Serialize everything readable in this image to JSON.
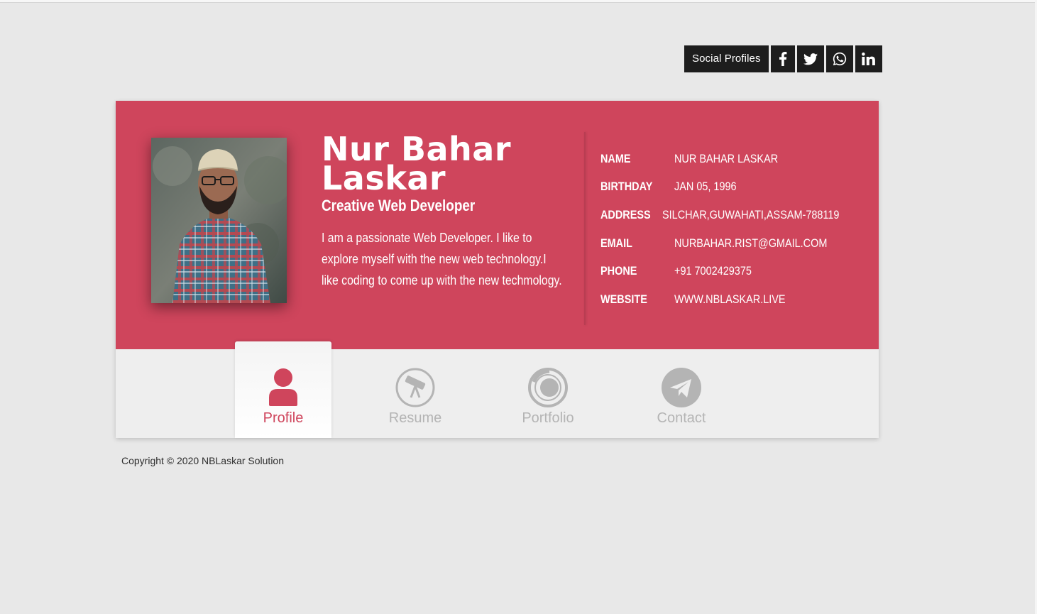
{
  "social": {
    "label": "Social Profiles",
    "icons": [
      "facebook-icon",
      "twitter-icon",
      "whatsapp-icon",
      "linkedin-icon"
    ]
  },
  "profile": {
    "name_line1": "Nur Bahar",
    "name_line2": "Laskar",
    "title": "Creative Web Developer",
    "bio": "I am a passionate Web Developer. I like to explore myself with the new web technology.I like coding to come up with the new techmology."
  },
  "info": [
    {
      "key": "NAME",
      "value": "NUR BAHAR LASKAR"
    },
    {
      "key": "BIRTHDAY",
      "value": "JAN 05, 1996"
    },
    {
      "key": "ADDRESS",
      "value": "SILCHAR,GUWAHATI,ASSAM-788119"
    },
    {
      "key": "EMAIL",
      "value": "NURBAHAR.RIST@GMAIL.COM"
    },
    {
      "key": "PHONE",
      "value": "+91 7002429375"
    },
    {
      "key": "WEBSITE",
      "value": "WWW.NBLASKAR.LIVE"
    }
  ],
  "tabs": [
    {
      "label": "Profile",
      "icon": "user-icon",
      "active": true
    },
    {
      "label": "Resume",
      "icon": "telescope-icon",
      "active": false
    },
    {
      "label": "Portfolio",
      "icon": "camera-lens-icon",
      "active": false
    },
    {
      "label": "Contact",
      "icon": "paper-plane-icon",
      "active": false
    }
  ],
  "colors": {
    "accent": "#cf455c",
    "background": "#e8e8e8",
    "social_bg": "#1d1d1d",
    "tab_inactive": "#b4b4b4"
  },
  "footer": {
    "copyright": "Copyright © 2020 NBLaskar Solution"
  }
}
